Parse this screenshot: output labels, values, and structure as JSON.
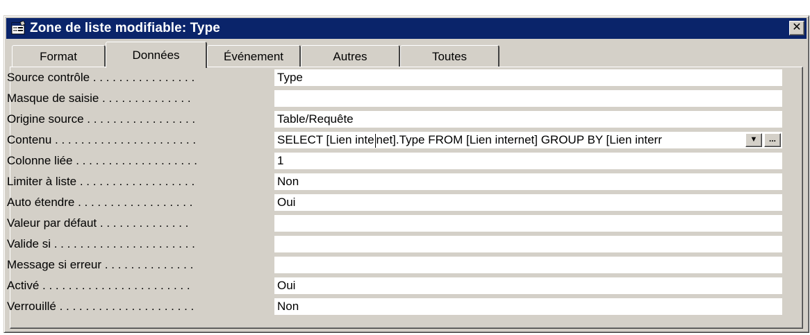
{
  "window": {
    "title": "Zone de liste modifiable: Type",
    "close_label": "✕"
  },
  "tabs": [
    {
      "label": "Format"
    },
    {
      "label": "Données"
    },
    {
      "label": "Événement"
    },
    {
      "label": "Autres"
    },
    {
      "label": "Toutes"
    }
  ],
  "active_tab": "Données",
  "properties": [
    {
      "label": "Source contrôle . . . . . . . . . . . . . . . .",
      "value": "Type"
    },
    {
      "label": "Masque de saisie . . . . . . . . . . . . . .",
      "value": ""
    },
    {
      "label": "Origine source . . . . . . . . . . . . . . . . .",
      "value": "Table/Requête"
    },
    {
      "label": "Contenu . . . . . . . . . . . . . . . . . . . . . .",
      "value_before_caret": "SELECT [Lien inte",
      "value_after_caret": "net].Type FROM [Lien internet] GROUP BY [Lien interr"
    },
    {
      "label": "Colonne liée . . . . . . . . . . . . . . . . . . .",
      "value": "1"
    },
    {
      "label": "Limiter à liste . . . . . . . . . . . . . . . . . .",
      "value": "Non"
    },
    {
      "label": "Auto étendre . . . . . . . . . . . . . . . . . .",
      "value": "Oui"
    },
    {
      "label": "Valeur par défaut . . . . . . . . . . . . . .",
      "value": ""
    },
    {
      "label": "Valide si . . . . . . . . . . . . . . . . . . . . . .",
      "value": ""
    },
    {
      "label": "Message si erreur . . . . . . . . . . . . . .",
      "value": ""
    },
    {
      "label": "Activé . . . . . . . . . . . . . . . . . . . . . . .",
      "value": "Oui"
    },
    {
      "label": "Verrouillé . . . . . . . . . . . . . . . . . . . . .",
      "value": "Non"
    }
  ],
  "buttons": {
    "dropdown_symbol": "▼",
    "build_symbol": "..."
  },
  "icons": {
    "title_icon": "property-sheet-icon",
    "dropdown_icon": "chevron-down-icon",
    "build_icon": "ellipsis-icon",
    "close_icon": "close-icon"
  },
  "colors": {
    "titlebar": "#0a246a",
    "face": "#d4d0c8"
  }
}
